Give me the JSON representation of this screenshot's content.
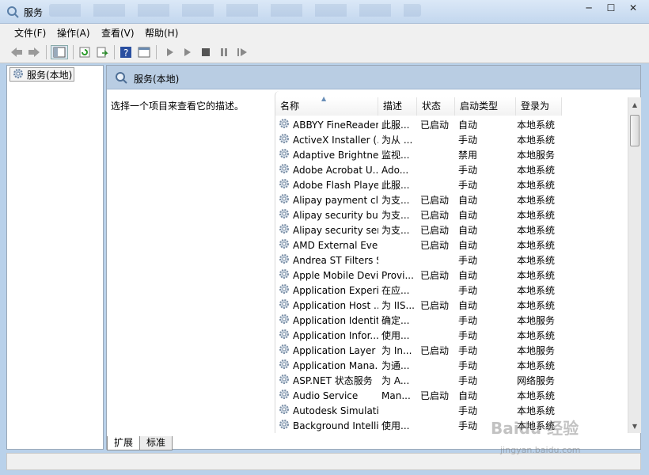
{
  "window": {
    "title": "服务"
  },
  "menu": [
    "文件(F)",
    "操作(A)",
    "查看(V)",
    "帮助(H)"
  ],
  "toolbar_icons": [
    "back-icon",
    "forward-icon",
    "show-tree-icon",
    "refresh-icon",
    "export-icon",
    "help-icon",
    "properties-icon",
    "start-icon",
    "start-alt-icon",
    "stop-icon",
    "pause-icon",
    "resume-icon"
  ],
  "tree": {
    "root_label": "服务(本地)"
  },
  "panel": {
    "header_title": "服务(本地)",
    "description": "选择一个项目来查看它的描述。"
  },
  "columns": [
    "名称",
    "描述",
    "状态",
    "启动类型",
    "登录为"
  ],
  "services": [
    {
      "name": "ABBYY FineReader...",
      "desc": "此服...",
      "status": "已启动",
      "startup": "自动",
      "logon": "本地系统"
    },
    {
      "name": "ActiveX Installer (...",
      "desc": "为从 ...",
      "status": "",
      "startup": "手动",
      "logon": "本地系统"
    },
    {
      "name": "Adaptive Brightness",
      "desc": "监视...",
      "status": "",
      "startup": "禁用",
      "logon": "本地服务"
    },
    {
      "name": "Adobe Acrobat U...",
      "desc": "Ado...",
      "status": "",
      "startup": "手动",
      "logon": "本地系统"
    },
    {
      "name": "Adobe Flash Playe...",
      "desc": "此服...",
      "status": "",
      "startup": "手动",
      "logon": "本地系统"
    },
    {
      "name": "Alipay payment cl...",
      "desc": "为支...",
      "status": "已启动",
      "startup": "自动",
      "logon": "本地系统"
    },
    {
      "name": "Alipay security bu...",
      "desc": "为支...",
      "status": "已启动",
      "startup": "自动",
      "logon": "本地系统"
    },
    {
      "name": "Alipay security ser...",
      "desc": "为支...",
      "status": "已启动",
      "startup": "自动",
      "logon": "本地系统"
    },
    {
      "name": "AMD External Eve...",
      "desc": "",
      "status": "已启动",
      "startup": "自动",
      "logon": "本地系统"
    },
    {
      "name": "Andrea ST Filters S...",
      "desc": "",
      "status": "",
      "startup": "手动",
      "logon": "本地系统"
    },
    {
      "name": "Apple Mobile Devi...",
      "desc": "Provi...",
      "status": "已启动",
      "startup": "自动",
      "logon": "本地系统"
    },
    {
      "name": "Application Experi...",
      "desc": "在应...",
      "status": "",
      "startup": "手动",
      "logon": "本地系统"
    },
    {
      "name": "Application Host ...",
      "desc": "为 IIS...",
      "status": "已启动",
      "startup": "自动",
      "logon": "本地系统"
    },
    {
      "name": "Application Identity",
      "desc": "确定...",
      "status": "",
      "startup": "手动",
      "logon": "本地服务"
    },
    {
      "name": "Application Infor...",
      "desc": "使用...",
      "status": "",
      "startup": "手动",
      "logon": "本地系统"
    },
    {
      "name": "Application Layer ...",
      "desc": "为 In...",
      "status": "已启动",
      "startup": "手动",
      "logon": "本地服务"
    },
    {
      "name": "Application Mana...",
      "desc": "为通...",
      "status": "",
      "startup": "手动",
      "logon": "本地系统"
    },
    {
      "name": "ASP.NET 状态服务",
      "desc": "为 A...",
      "status": "",
      "startup": "手动",
      "logon": "网络服务"
    },
    {
      "name": "Audio Service",
      "desc": "Man...",
      "status": "已启动",
      "startup": "自动",
      "logon": "本地系统"
    },
    {
      "name": "Autodesk Simulati...",
      "desc": "",
      "status": "",
      "startup": "手动",
      "logon": "本地系统"
    },
    {
      "name": "Background Intelli...",
      "desc": "使用...",
      "status": "",
      "startup": "手动",
      "logon": "本地系统"
    }
  ],
  "tabs": [
    "扩展",
    "标准"
  ],
  "watermark": {
    "main": "Baidu 经验",
    "sub": "jingyan.baidu.com"
  }
}
